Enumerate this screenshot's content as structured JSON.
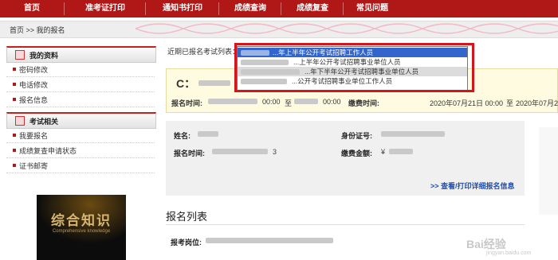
{
  "nav": {
    "items": [
      "首页",
      "准考证打印",
      "通知书打印",
      "成绩查询",
      "成绩复查",
      "常见问题"
    ]
  },
  "breadcrumb": "首页 >> 我的报名",
  "sidebar": {
    "section1": {
      "title": "我的资料",
      "items": [
        "密码修改",
        "电话修改",
        "报名信息"
      ]
    },
    "section2": {
      "title": "考试相关",
      "items": [
        "我要报名",
        "成绩复查申请状态",
        "证书邮寄"
      ]
    },
    "book": {
      "title": "综合知识",
      "subtitle": "Comprehensive knowledge"
    }
  },
  "main": {
    "recent_label": "近期已报名考试列表：",
    "dropdown_options": [
      "...年上半年公开考试招聘工作人员",
      "...上半年公开考试招聘事业单位人员",
      "...年下半年公开考试招聘事业单位人员",
      "...公开考试招聘事业单位工作人员"
    ],
    "info": {
      "heading": "C：",
      "time_label": "报名时间:",
      "time_a": "00:00",
      "to_a": "至",
      "time_b": "00:00",
      "pay_label": "缴费时间:",
      "pay_start": "2020年07月21日 00:00",
      "to_b": "至",
      "pay_end": "2020年07月24日"
    },
    "card": {
      "name_label": "姓名:",
      "id_label": "身份证号:",
      "time_label": "报名时间:",
      "time_suffix": "3",
      "fee_label": "缴费金额:",
      "fee_value": "¥",
      "detail_link": ">> 查看/打印详细报名信息"
    },
    "list_title": "报名列表",
    "position_label": "报考岗位:"
  },
  "watermark": {
    "text": "Bai经验",
    "url": "jingyan.baidu.com"
  },
  "colors": {
    "nav_bg": "#b01818",
    "highlight": "#d4151b",
    "link": "#1f4db0",
    "info_bg": "#fffbe0"
  }
}
